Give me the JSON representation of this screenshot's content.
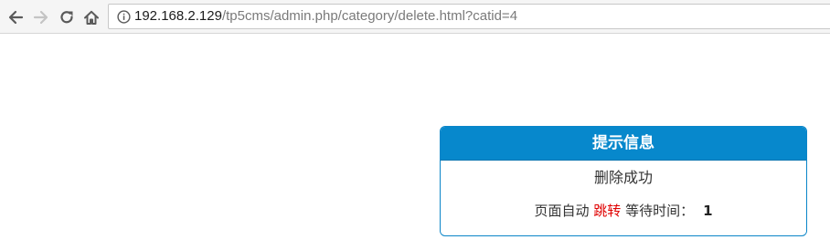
{
  "browser": {
    "url_host": "192.168.2.129",
    "url_path": "/tp5cms/admin.php/category/delete.html?catid=4",
    "icons": {
      "back": "arrow-left-icon",
      "forward": "arrow-right-icon",
      "reload": "reload-icon",
      "home": "home-icon",
      "site_info": "info-icon"
    }
  },
  "message": {
    "title": "提示信息",
    "text": "删除成功",
    "jump_prefix": "页面自动",
    "jump_link": "跳转",
    "wait_label": "等待时间：",
    "wait_seconds": "1",
    "colors": {
      "header_bg": "#0788cc",
      "border": "#0a85c8",
      "link": "#e00000"
    }
  }
}
